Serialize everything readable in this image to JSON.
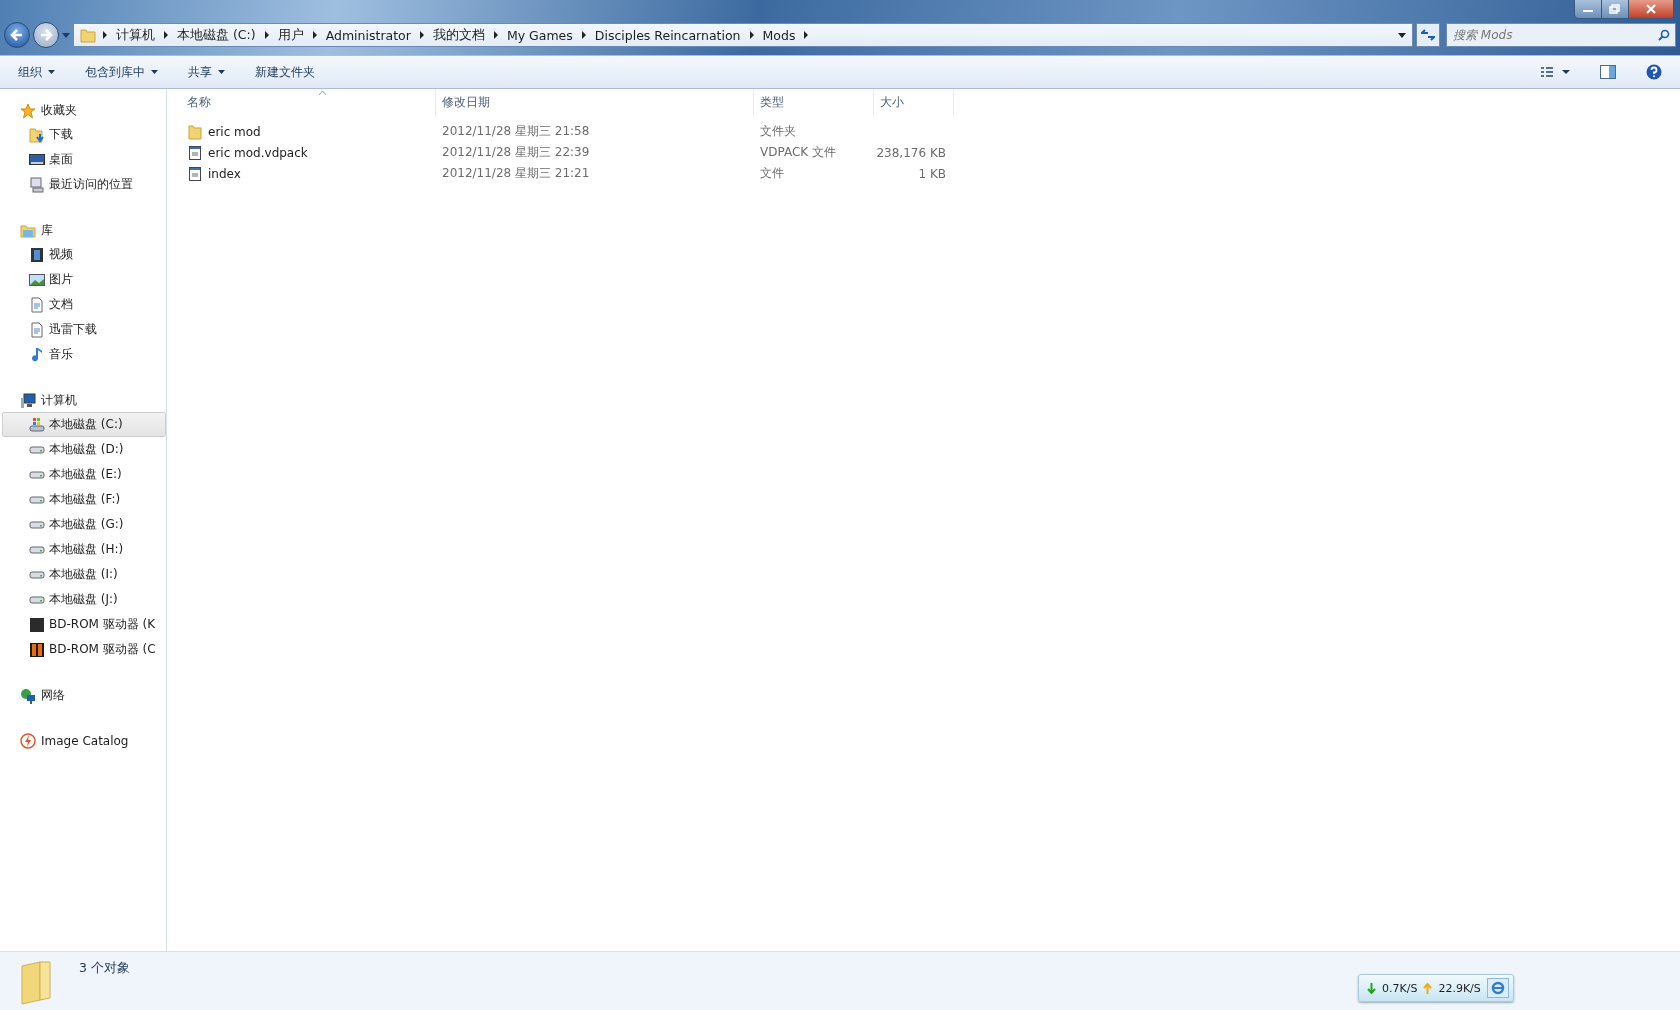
{
  "breadcrumb": [
    "计算机",
    "本地磁盘 (C:)",
    "用户",
    "Administrator",
    "我的文档",
    "My Games",
    "Disciples Reincarnation",
    "Mods"
  ],
  "search": {
    "placeholder": "搜索 Mods"
  },
  "toolbar": [
    {
      "label": "组织",
      "dropdown": true
    },
    {
      "label": "包含到库中",
      "dropdown": true
    },
    {
      "label": "共享",
      "dropdown": true
    },
    {
      "label": "新建文件夹",
      "dropdown": false
    }
  ],
  "sidebar": [
    {
      "label": "收藏夹",
      "kind": "star",
      "children": [
        {
          "label": "下载",
          "kind": "download",
          "selected": false
        },
        {
          "label": "桌面",
          "kind": "desktop",
          "selected": false
        },
        {
          "label": "最近访问的位置",
          "kind": "recent",
          "selected": false
        }
      ]
    },
    {
      "label": "库",
      "kind": "library",
      "children": [
        {
          "label": "视频",
          "kind": "video",
          "selected": false
        },
        {
          "label": "图片",
          "kind": "picture",
          "selected": false
        },
        {
          "label": "文档",
          "kind": "document",
          "selected": false
        },
        {
          "label": "迅雷下载",
          "kind": "document",
          "selected": false
        },
        {
          "label": "音乐",
          "kind": "music",
          "selected": false
        }
      ]
    },
    {
      "label": "计算机",
      "kind": "computer",
      "children": [
        {
          "label": "本地磁盘 (C:)",
          "kind": "sysdrive",
          "selected": true
        },
        {
          "label": "本地磁盘 (D:)",
          "kind": "drive",
          "selected": false
        },
        {
          "label": "本地磁盘 (E:)",
          "kind": "drive",
          "selected": false
        },
        {
          "label": "本地磁盘 (F:)",
          "kind": "drive",
          "selected": false
        },
        {
          "label": "本地磁盘 (G:)",
          "kind": "drive",
          "selected": false
        },
        {
          "label": "本地磁盘 (H:)",
          "kind": "drive",
          "selected": false
        },
        {
          "label": "本地磁盘 (I:)",
          "kind": "drive",
          "selected": false
        },
        {
          "label": "本地磁盘 (J:)",
          "kind": "drive",
          "selected": false
        },
        {
          "label": "BD-ROM 驱动器 (K",
          "kind": "disc",
          "selected": false
        },
        {
          "label": "BD-ROM 驱动器 (C",
          "kind": "disc2",
          "selected": false
        }
      ]
    },
    {
      "label": "网络",
      "kind": "network"
    },
    {
      "label": "Image Catalog",
      "kind": "catalog"
    }
  ],
  "columns": [
    "名称",
    "修改日期",
    "类型",
    "大小"
  ],
  "files": [
    {
      "name": "eric mod",
      "date": "2012/11/28 星期三 21:58",
      "type": "文件夹",
      "kind": "folder"
    },
    {
      "name": "eric mod.vdpack",
      "date": "2012/11/28 星期三 22:39",
      "type": "VDPACK 文件",
      "size": "238,176 KB",
      "kind": "file"
    },
    {
      "name": "index",
      "date": "2012/11/28 星期三 21:21",
      "type": "文件",
      "size": "1 KB",
      "kind": "file"
    }
  ],
  "status_bar": {
    "count": "3 个对象"
  },
  "net_widget": {
    "down": "0.7K/S",
    "up": "22.9K/S"
  }
}
